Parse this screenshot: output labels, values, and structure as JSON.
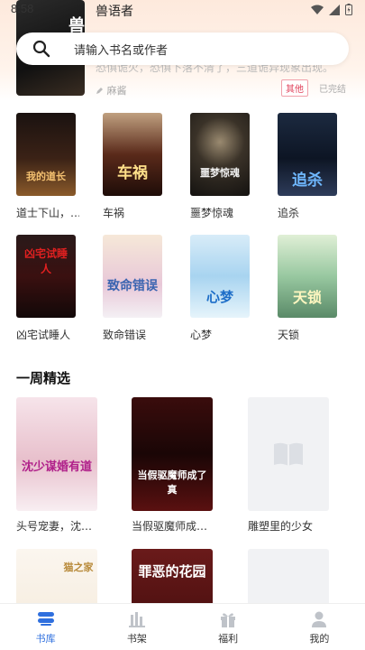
{
  "status_bar": {
    "time": "8:58"
  },
  "top_card": {
    "title": "兽语者",
    "cover_text": "兽",
    "description": "恐惧诡火，恐惧下落不清了，三道诡异现象出现。",
    "author": "麻酱",
    "tag": "其他",
    "status": "已完结"
  },
  "search": {
    "placeholder": "请输入书名或作者"
  },
  "grid_books": [
    {
      "title": "道士下山，…",
      "cover_text": "我的道长"
    },
    {
      "title": "车祸",
      "cover_text": "车祸"
    },
    {
      "title": "噩梦惊魂",
      "cover_text": "噩梦惊魂"
    },
    {
      "title": "追杀",
      "cover_text": "追杀"
    },
    {
      "title": "凶宅试睡人",
      "cover_text": "凶宅试睡人"
    },
    {
      "title": "致命错误",
      "cover_text": "致命错误"
    },
    {
      "title": "心梦",
      "cover_text": "心梦"
    },
    {
      "title": "天锁",
      "cover_text": "天锁"
    }
  ],
  "weekly": {
    "title": "一周精选",
    "books": [
      {
        "title": "头号宠妻，沈…",
        "cover_text": "沈少谋婚有道"
      },
      {
        "title": "当假驱魔师成…",
        "cover_text": "当假驱魔师成了真"
      },
      {
        "title": "雕塑里的少女",
        "cover_text": ""
      },
      {
        "title": "",
        "cover_text": "猫之家"
      },
      {
        "title": "",
        "cover_text": "罪恶的花园"
      },
      {
        "title": "",
        "cover_text": ""
      }
    ]
  },
  "bottom_nav": [
    {
      "label": "书库",
      "icon": "library-icon",
      "active": true
    },
    {
      "label": "书架",
      "icon": "bookshelf-icon",
      "active": false
    },
    {
      "label": "福利",
      "icon": "gift-icon",
      "active": false
    },
    {
      "label": "我的",
      "icon": "profile-icon",
      "active": false
    }
  ],
  "colors": {
    "accent": "#2f6fde",
    "tag_red": "#e0405a"
  }
}
